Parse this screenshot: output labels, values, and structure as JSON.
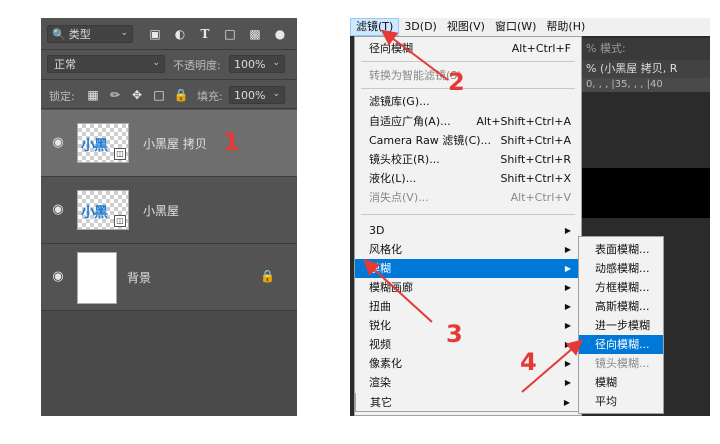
{
  "layers_panel": {
    "kind_filter": "类型",
    "blend_mode": "正常",
    "opacity_label": "不透明度:",
    "opacity_value": "100%",
    "lock_label": "锁定:",
    "fill_label": "填充:",
    "fill_value": "100%",
    "layers": [
      {
        "name": "小黑屋 拷贝",
        "thumb_text": "小黑",
        "selected": true
      },
      {
        "name": "小黑屋",
        "thumb_text": "小黑",
        "selected": false
      },
      {
        "name": "背景",
        "locked": true
      }
    ]
  },
  "menubar": {
    "items": [
      "滤镜(T)",
      "3D(D)",
      "视图(V)",
      "窗口(W)",
      "帮助(H)"
    ],
    "active": "滤镜(T)"
  },
  "background_ui": {
    "mode_text": "% 模式:",
    "doc_tab": "% (小黑屋 拷贝, R",
    "ruler_text": "0, , , |35, , , |40"
  },
  "filter_menu": {
    "items": [
      {
        "label": "径向模糊",
        "shortcut": "Alt+Ctrl+F"
      },
      {
        "label": "转换为智能滤镜(S)",
        "disabled": true
      },
      {
        "label": "滤镜库(G)..."
      },
      {
        "label": "自适应广角(A)...",
        "shortcut": "Alt+Shift+Ctrl+A"
      },
      {
        "label": "Camera Raw 滤镜(C)...",
        "shortcut": "Shift+Ctrl+A"
      },
      {
        "label": "镜头校正(R)...",
        "shortcut": "Shift+Ctrl+R"
      },
      {
        "label": "液化(L)...",
        "shortcut": "Shift+Ctrl+X"
      },
      {
        "label": "消失点(V)...",
        "shortcut": "Alt+Ctrl+V",
        "disabled": true
      },
      {
        "label": "3D",
        "submenu": true
      },
      {
        "label": "风格化",
        "submenu": true
      },
      {
        "label": "模糊",
        "submenu": true,
        "highlighted": true
      },
      {
        "label": "模糊画廊",
        "submenu": true
      },
      {
        "label": "扭曲",
        "submenu": true
      },
      {
        "label": "锐化",
        "submenu": true
      },
      {
        "label": "视频",
        "submenu": true
      },
      {
        "label": "像素化",
        "submenu": true
      },
      {
        "label": "渲染",
        "submenu": true
      },
      {
        "label": "杂色",
        "submenu": true
      },
      {
        "label": "其它",
        "submenu": true
      }
    ]
  },
  "blur_submenu": {
    "items": [
      {
        "label": "表面模糊..."
      },
      {
        "label": "动感模糊..."
      },
      {
        "label": "方框模糊..."
      },
      {
        "label": "高斯模糊..."
      },
      {
        "label": "进一步模糊"
      },
      {
        "label": "径向模糊...",
        "highlighted": true
      },
      {
        "label": "镜头模糊...",
        "disabled": true
      },
      {
        "label": "模糊"
      },
      {
        "label": "平均"
      }
    ]
  },
  "annotations": [
    "1",
    "2",
    "3",
    "4"
  ],
  "colors": {
    "accent": "#0078d7",
    "annotation": "#e53935",
    "panel": "#535353"
  }
}
